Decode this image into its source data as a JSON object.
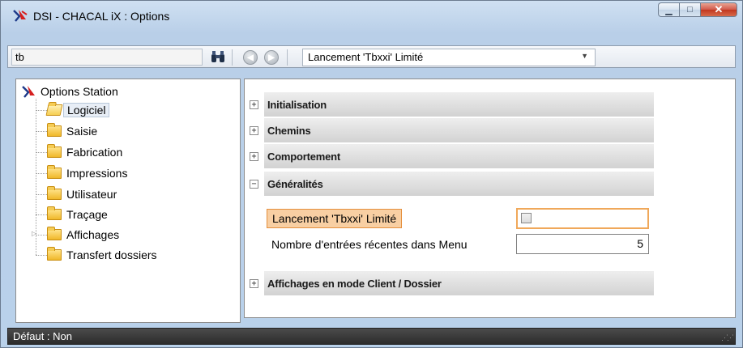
{
  "window": {
    "title": "DSI - CHACAL iX : Options",
    "controls": [
      "minimize-icon",
      "maximize-icon",
      "close-icon"
    ]
  },
  "toolbar": {
    "search_value": "tb",
    "result_value": "Lancement 'Tbxxi' Limité"
  },
  "tree": {
    "root": "Options Station",
    "items": [
      {
        "label": "Logiciel",
        "selected": true
      },
      {
        "label": "Saisie"
      },
      {
        "label": "Fabrication"
      },
      {
        "label": "Impressions"
      },
      {
        "label": "Utilisateur"
      },
      {
        "label": "Traçage"
      },
      {
        "label": "Affichages",
        "expandable": true
      },
      {
        "label": "Transfert dossiers"
      }
    ]
  },
  "sections": [
    {
      "label": "Initialisation",
      "toggle": "+"
    },
    {
      "label": "Chemins",
      "toggle": "+"
    },
    {
      "label": "Comportement",
      "toggle": "+"
    },
    {
      "label": "Généralités",
      "toggle": "−"
    },
    {
      "label": "Affichages en mode Client / Dossier",
      "toggle": "+"
    }
  ],
  "fields": {
    "tbxxi_label": "Lancement 'Tbxxi' Limité",
    "tbxxi_checked": false,
    "recent_label": "Nombre d'entrées récentes dans Menu",
    "recent_value": "5"
  },
  "status": {
    "text": "Défaut : Non"
  },
  "colors": {
    "highlight": "#f8cfa3",
    "highlight_border": "#e58f3c",
    "statusbar": "#333333"
  }
}
